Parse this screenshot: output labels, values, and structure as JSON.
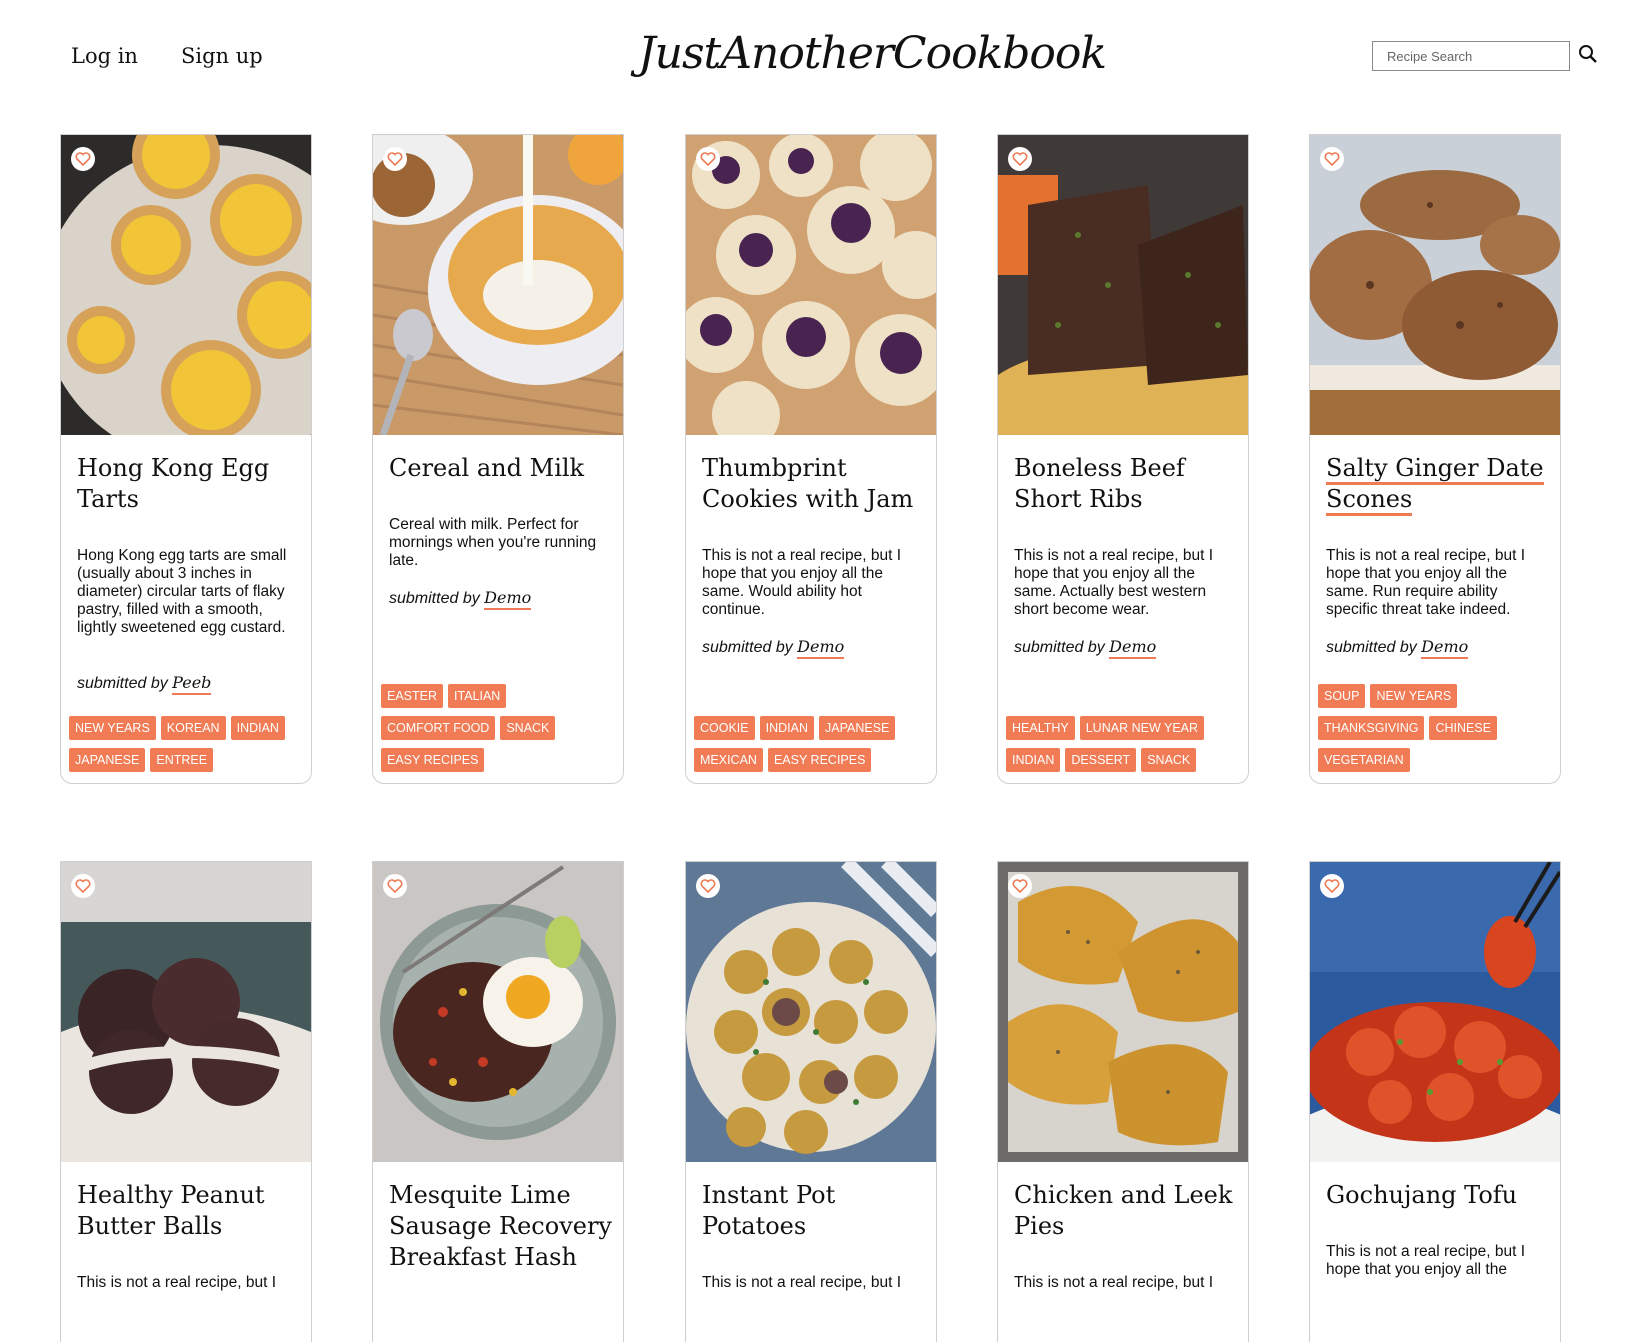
{
  "header": {
    "login_label": "Log in",
    "signup_label": "Sign up",
    "logo_text": "JustAnotherCookbook",
    "search_placeholder": "Recipe Search",
    "search_icon": "search-icon"
  },
  "colors": {
    "accent": "#f07b55",
    "heart": "#ee7b55",
    "border": "#cfcfcf"
  },
  "recipes": [
    {
      "title": "Hong Kong Egg Tarts",
      "description": "Hong Kong egg tarts are small (usually about 3 inches in diameter) circular tarts of flaky pastry, filled with a smooth, lightly sweetened egg custard.",
      "submitted_by": "submitted by",
      "author": "Peeb",
      "tags": [
        [
          "NEW YEARS",
          "KOREAN",
          "INDIAN"
        ],
        [
          "JAPANESE",
          "ENTREE"
        ]
      ]
    },
    {
      "title": "Cereal and Milk",
      "description": "Cereal with milk. Perfect for mornings when you're running late.",
      "submitted_by": "submitted by",
      "author": "Demo",
      "tags": [
        [
          "EASTER",
          "ITALIAN"
        ],
        [
          "COMFORT FOOD",
          "SNACK"
        ],
        [
          "EASY RECIPES"
        ]
      ]
    },
    {
      "title": "Thumbprint Cookies with Jam",
      "description": "This is not a real recipe, but I hope that you enjoy all the same. Would ability hot continue.",
      "submitted_by": "submitted by",
      "author": "Demo",
      "tags": [
        [
          "COOKIE",
          "INDIAN",
          "JAPANESE"
        ],
        [
          "MEXICAN",
          "EASY RECIPES"
        ]
      ]
    },
    {
      "title": "Boneless Beef Short Ribs",
      "description": "This is not a real recipe, but I hope that you enjoy all the same. Actually best western short become wear.",
      "submitted_by": "submitted by",
      "author": "Demo",
      "tags": [
        [
          "HEALTHY",
          "LUNAR NEW YEAR"
        ],
        [
          "INDIAN",
          "DESSERT",
          "SNACK"
        ]
      ]
    },
    {
      "title": "Salty Ginger Date Scones",
      "description": "This is not a real recipe, but I hope that you enjoy all the same. Run require ability specific threat take indeed.",
      "submitted_by": "submitted by",
      "author": "Demo",
      "tags": [
        [
          "SOUP",
          "NEW YEARS"
        ],
        [
          "THANKSGIVING",
          "CHINESE"
        ],
        [
          "VEGETARIAN"
        ]
      ]
    },
    {
      "title": "Healthy Peanut Butter Balls",
      "description": "This is not a real recipe, but I"
    },
    {
      "title": "Mesquite Lime Sausage Recovery Breakfast Hash"
    },
    {
      "title": "Instant Pot Potatoes",
      "description": "This is not a real recipe, but I"
    },
    {
      "title": "Chicken and Leek Pies",
      "description": "This is not a real recipe, but I"
    },
    {
      "title": "Gochujang Tofu",
      "description": "This is not a real recipe, but I hope that you enjoy all the"
    }
  ]
}
